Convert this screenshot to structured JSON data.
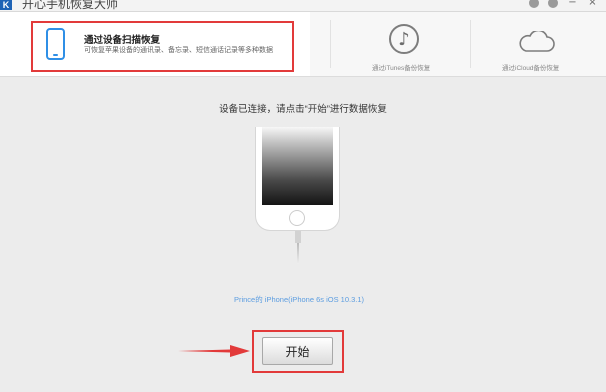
{
  "window": {
    "title": "开心手机恢复大师",
    "logo_letter": "K",
    "controls": [
      "chat-icon",
      "feedback-icon",
      "minimize-icon",
      "close-icon"
    ]
  },
  "modes": {
    "device": {
      "title": "通过设备扫描恢复",
      "desc": "可恢复苹果设备的通讯录、备忘录、短信通话记录等多种数据",
      "icon": "phone-icon",
      "selected": true
    },
    "itunes": {
      "label": "通过iTunes备份恢复",
      "icon": "music-note-icon"
    },
    "icloud": {
      "label": "通过iCloud备份恢复",
      "icon": "cloud-icon"
    }
  },
  "main": {
    "status": "设备已连接，请点击“开始”进行数据恢复",
    "device_label": "Prince的 iPhone(iPhone 6s iOS 10.3.1)",
    "start_label": "开始"
  },
  "colors": {
    "accent_blue": "#2f8fe6",
    "highlight_red": "#e23a3a",
    "link_blue": "#5c9de0"
  }
}
